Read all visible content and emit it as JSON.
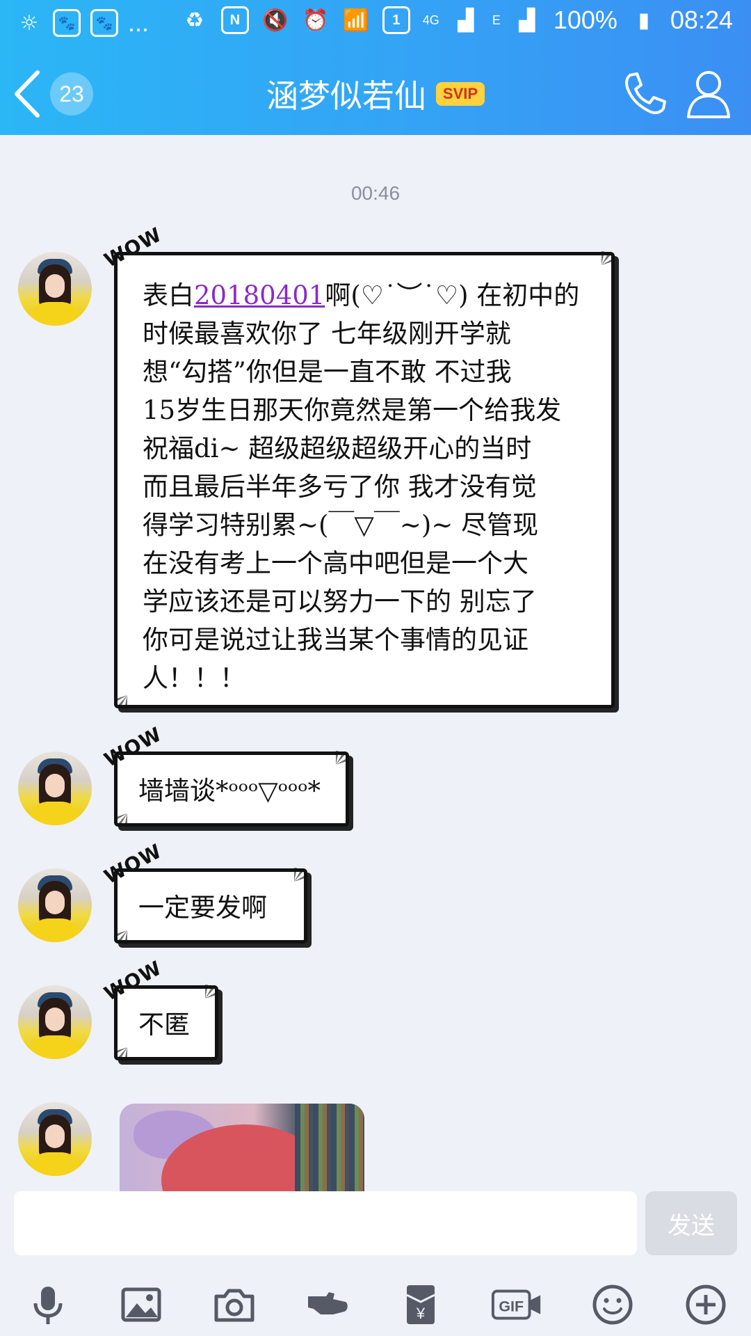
{
  "status_bar": {
    "battery": "100%",
    "time": "08:24",
    "network": "4G",
    "network_e": "E",
    "notif_more": "...",
    "sim": "1"
  },
  "header": {
    "back_count": "23",
    "title": "涵梦似若仙",
    "badge": "SVIP"
  },
  "chat": {
    "timestamp": "00:46",
    "wow": "WOW",
    "messages": [
      {
        "text_before": "表白",
        "link": "20180401",
        "text_after": "啊(♡˙︶˙♡) 在初中的\n时候最喜欢你了 七年级刚开学就\n想“勾搭”你但是一直不敢 不过我\n15岁生日那天你竟然是第一个给我发\n祝福di~ 超级超级超级开心的当时\n而且最后半年多亏了你 我才没有觉\n得学习特别累~(￣▽￣~)~ 尽管现\n在没有考上一个高中吧但是一个大\n学应该还是可以努力一下的 别忘了\n你可是说过让我当某个事情的见证\n人！！！"
      },
      {
        "text": "墙墙谈*ᵒᵒᵒ▽ᵒᵒᵒ*"
      },
      {
        "text": "一定要发啊"
      },
      {
        "text": "不匿"
      }
    ]
  },
  "input": {
    "placeholder": "",
    "send_label": "发送"
  },
  "toolbar": {
    "icons": [
      "microphone-icon",
      "image-icon",
      "camera-icon",
      "poke-icon",
      "red-packet-icon",
      "gif-icon",
      "emoji-icon",
      "plus-icon"
    ],
    "gif_label": "GIF",
    "yen_label": "¥"
  },
  "colors": {
    "header_start": "#2bb6f6",
    "header_end": "#3b8ff3",
    "svip_bg": "#ffd23e",
    "link": "#8a2bc8",
    "background": "#eef1f7"
  }
}
